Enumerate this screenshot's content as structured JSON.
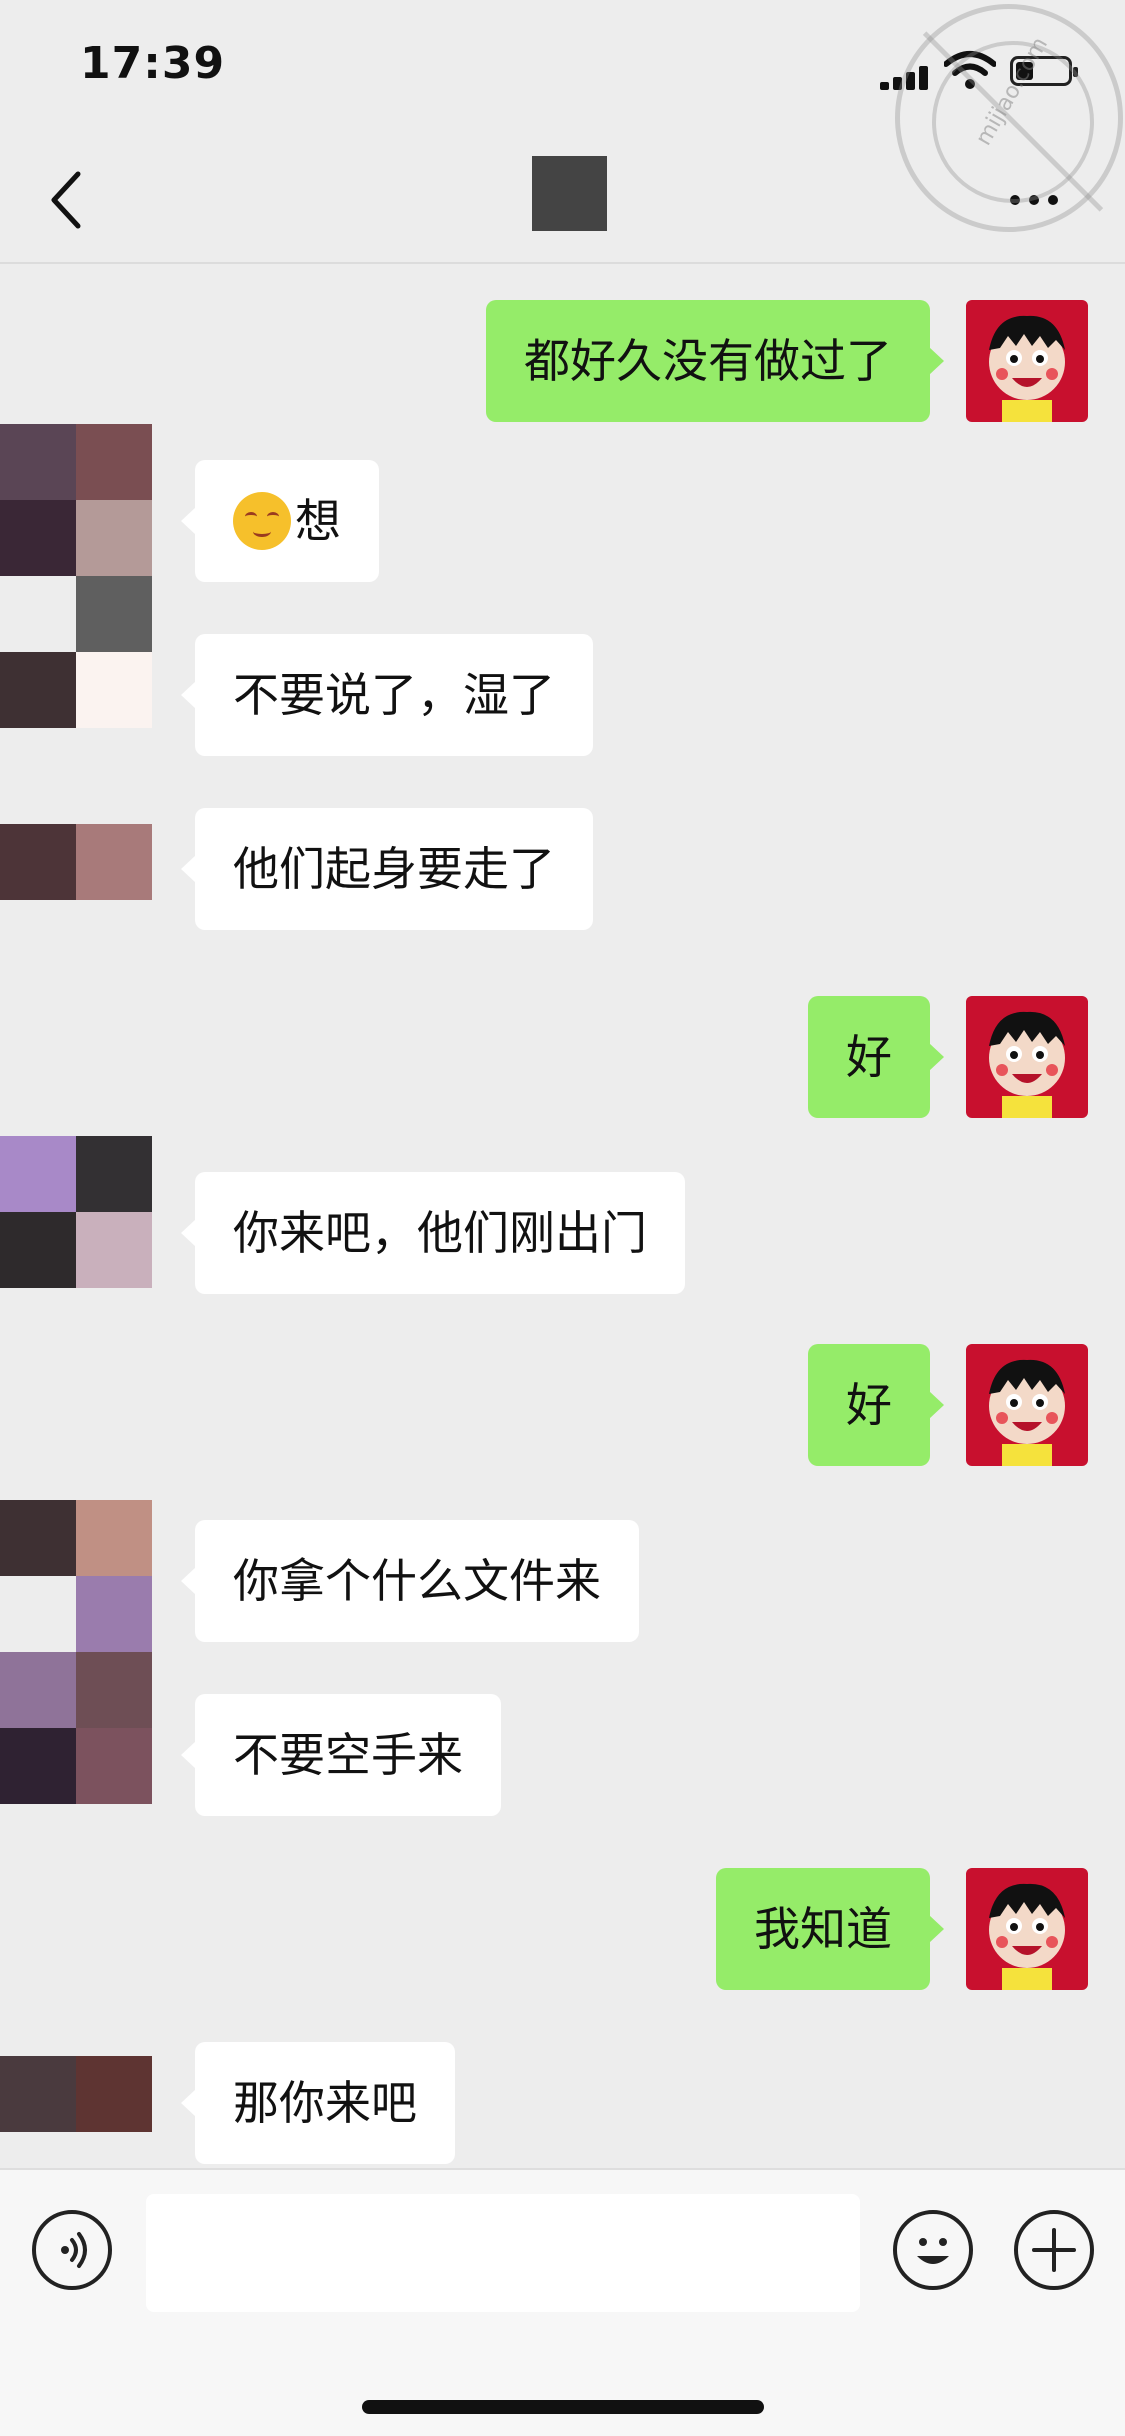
{
  "status_bar": {
    "time": "17:39",
    "battery_level": 0.3
  },
  "nav": {
    "back_icon": "chevron-left-icon",
    "more_icon": "ellipsis-icon"
  },
  "watermark": {
    "text": "mijiao.com"
  },
  "messages": [
    {
      "direction": "out",
      "text": "都好久没有做过了"
    },
    {
      "direction": "in",
      "emoji": "smiling-blushing-emoji",
      "text": "想"
    },
    {
      "direction": "in",
      "text": "不要说了，湿了"
    },
    {
      "direction": "in",
      "text": "他们起身要走了"
    },
    {
      "direction": "out",
      "text": "好"
    },
    {
      "direction": "in",
      "text": "你来吧，他们刚出门"
    },
    {
      "direction": "out",
      "text": "好"
    },
    {
      "direction": "in",
      "text": "你拿个什么文件来"
    },
    {
      "direction": "in",
      "text": "不要空手来"
    },
    {
      "direction": "out",
      "text": "我知道"
    },
    {
      "direction": "in",
      "text": "那你来吧"
    }
  ],
  "input_bar": {
    "voice_icon": "voice-icon",
    "input_value": "",
    "emoji_icon": "smiley-icon",
    "plus_icon": "plus-icon"
  },
  "colors": {
    "background": "#ededed",
    "outgoing_bubble": "#95ec69",
    "incoming_bubble": "#ffffff",
    "self_avatar": "#c8102e"
  }
}
